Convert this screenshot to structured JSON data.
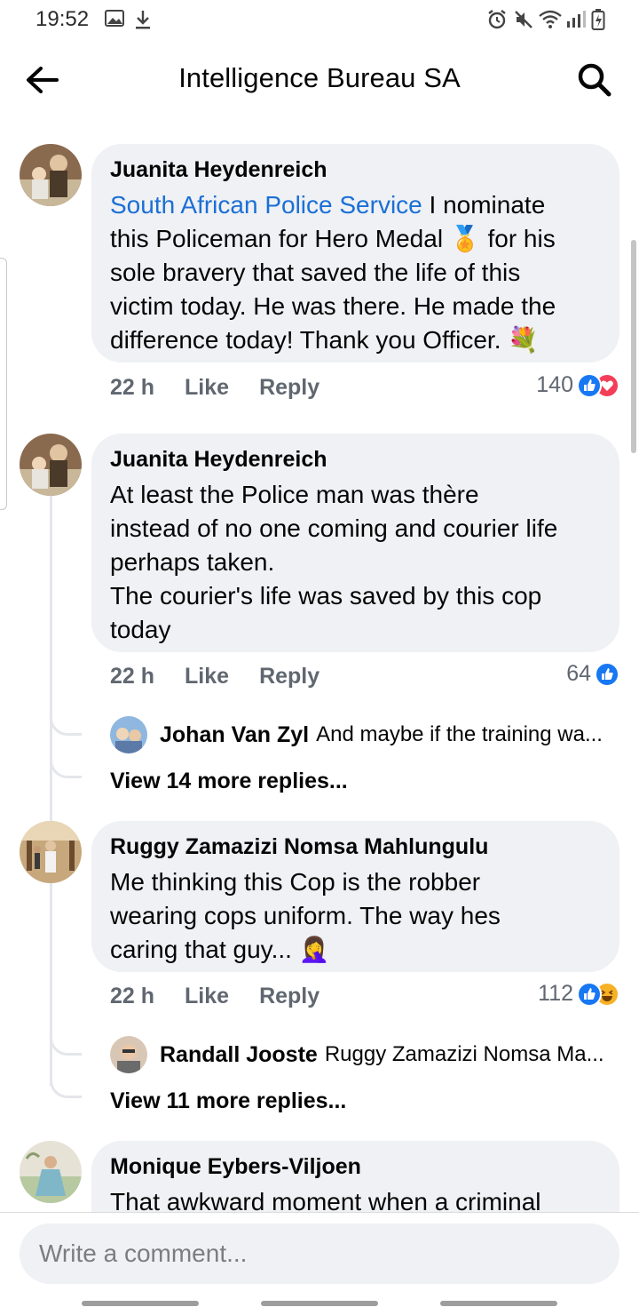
{
  "status_bar": {
    "time": "19:52"
  },
  "header": {
    "title": "Intelligence Bureau SA"
  },
  "comments": [
    {
      "author": "Juanita Heydenreich",
      "mention": "South African Police Service",
      "text_lines": [
        "I nominate",
        "this Policeman for Hero Medal 🏅 for his",
        "sole bravery that saved the life of this",
        "victim today. He was there. He made the",
        "difference today! Thank you Officer. 💐"
      ],
      "time": "22 h",
      "like_label": "Like",
      "reply_label": "Reply",
      "reaction_count": "140"
    },
    {
      "author": "Juanita Heydenreich",
      "text_lines": [
        "At least the Police man was thère",
        "instead of no one coming and courier life",
        "perhaps taken.",
        "The courier's life was saved by this cop",
        "today"
      ],
      "time": "22 h",
      "like_label": "Like",
      "reply_label": "Reply",
      "reaction_count": "64",
      "reply_preview": {
        "author": "Johan Van Zyl",
        "text": "And maybe if the training wa..."
      },
      "view_more": "View 14 more replies..."
    },
    {
      "author": "Ruggy Zamazizi Nomsa Mahlungulu",
      "text_lines": [
        "Me thinking this Cop is the robber",
        "wearing cops uniform. The way hes",
        "caring that guy... 🤦‍♀️"
      ],
      "time": "22 h",
      "like_label": "Like",
      "reply_label": "Reply",
      "reaction_count": "112",
      "reply_preview": {
        "author": "Randall Jooste",
        "text": "Ruggy Zamazizi Nomsa Ma..."
      },
      "view_more": "View 11 more replies..."
    },
    {
      "author": "Monique Eybers-Viljoen",
      "text_lines": [
        "That awkward moment when a criminal"
      ]
    }
  ],
  "composer": {
    "placeholder": "Write a comment..."
  },
  "colors": {
    "like_blue": "#1877f2",
    "love_red": "#f33e58",
    "haha_yellow": "#f7b125",
    "link_blue": "#1b6fd6"
  }
}
